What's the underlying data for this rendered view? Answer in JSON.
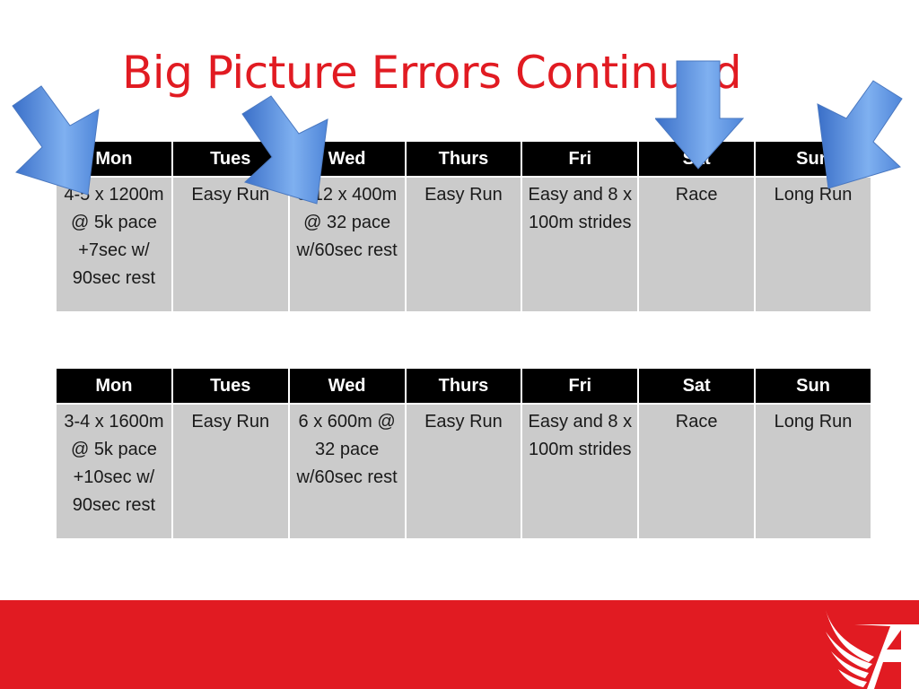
{
  "slide": {
    "title": "Big Picture Errors Continued",
    "accent_color": "#e11b22",
    "arrow_color": "#4f86d9"
  },
  "tables": [
    {
      "headers": [
        "Mon",
        "Tues",
        "Wed",
        "Thurs",
        "Fri",
        "Sat",
        "Sun"
      ],
      "cells": [
        "4-5 x 1200m @ 5k pace +7sec w/ 90sec rest",
        "Easy Run",
        "9-12 x 400m @ 32 pace w/60sec rest",
        "Easy Run",
        "Easy and 8 x 100m strides",
        "Race",
        "Long Run"
      ]
    },
    {
      "headers": [
        "Mon",
        "Tues",
        "Wed",
        "Thurs",
        "Fri",
        "Sat",
        "Sun"
      ],
      "cells": [
        "3-4 x 1600m @ 5k pace +10sec w/ 90sec rest",
        "Easy Run",
        "6 x 600m @ 32 pace w/60sec rest",
        "Easy Run",
        "Easy and 8 x 100m strides",
        "Race",
        "Long Run"
      ]
    }
  ],
  "annotations": {
    "arrows": [
      "arrow-pointing-mon",
      "arrow-pointing-wed",
      "arrow-pointing-sat",
      "arrow-pointing-sun"
    ]
  },
  "footer": {
    "logo": "winged-a-logo-icon"
  }
}
